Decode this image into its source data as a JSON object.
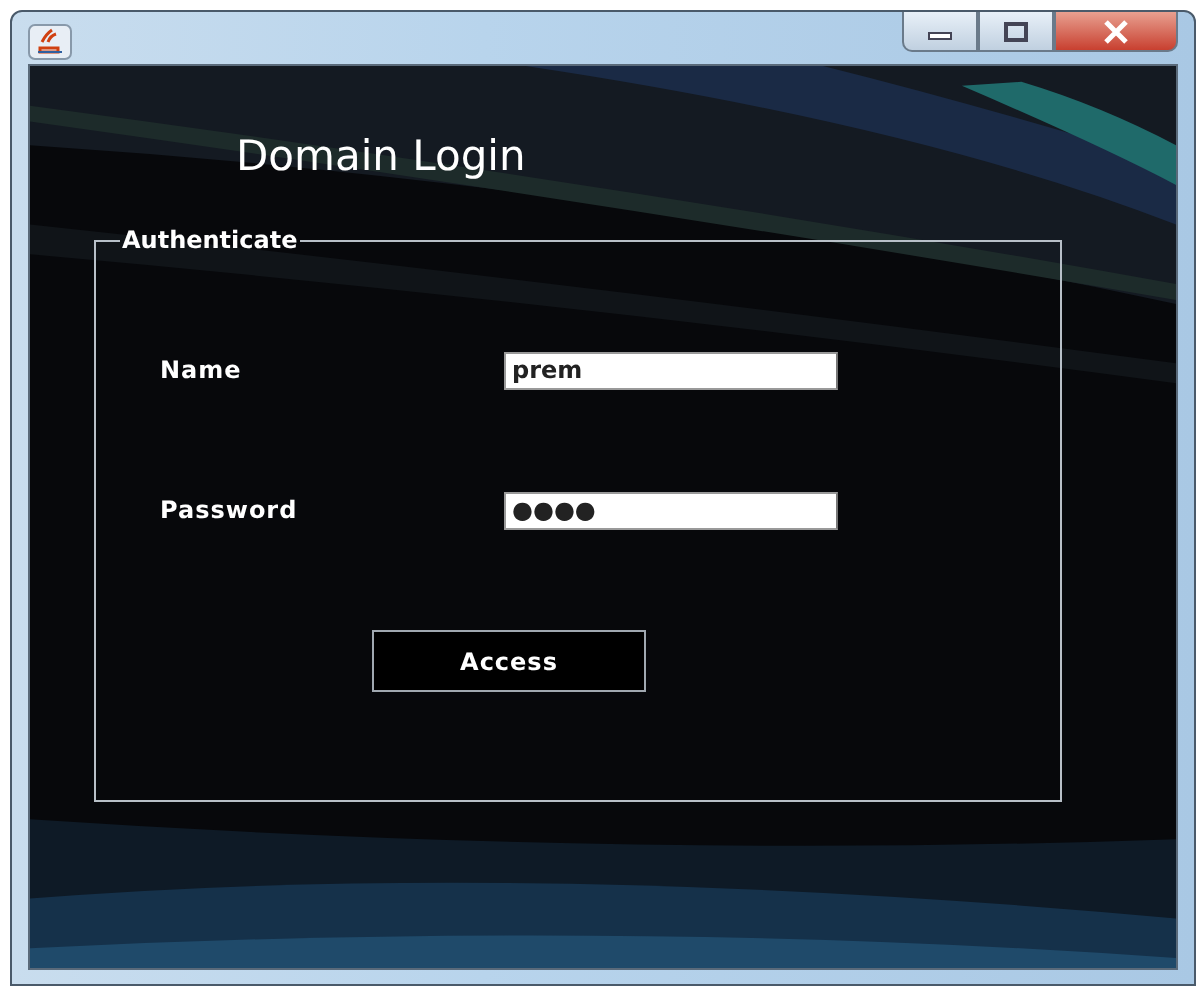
{
  "heading": "Domain Login",
  "group": {
    "legend": "Authenticate",
    "fields": [
      {
        "label": "Name",
        "value": "prem"
      },
      {
        "label": "Password",
        "value": "●●●●"
      }
    ],
    "button": "Access"
  }
}
